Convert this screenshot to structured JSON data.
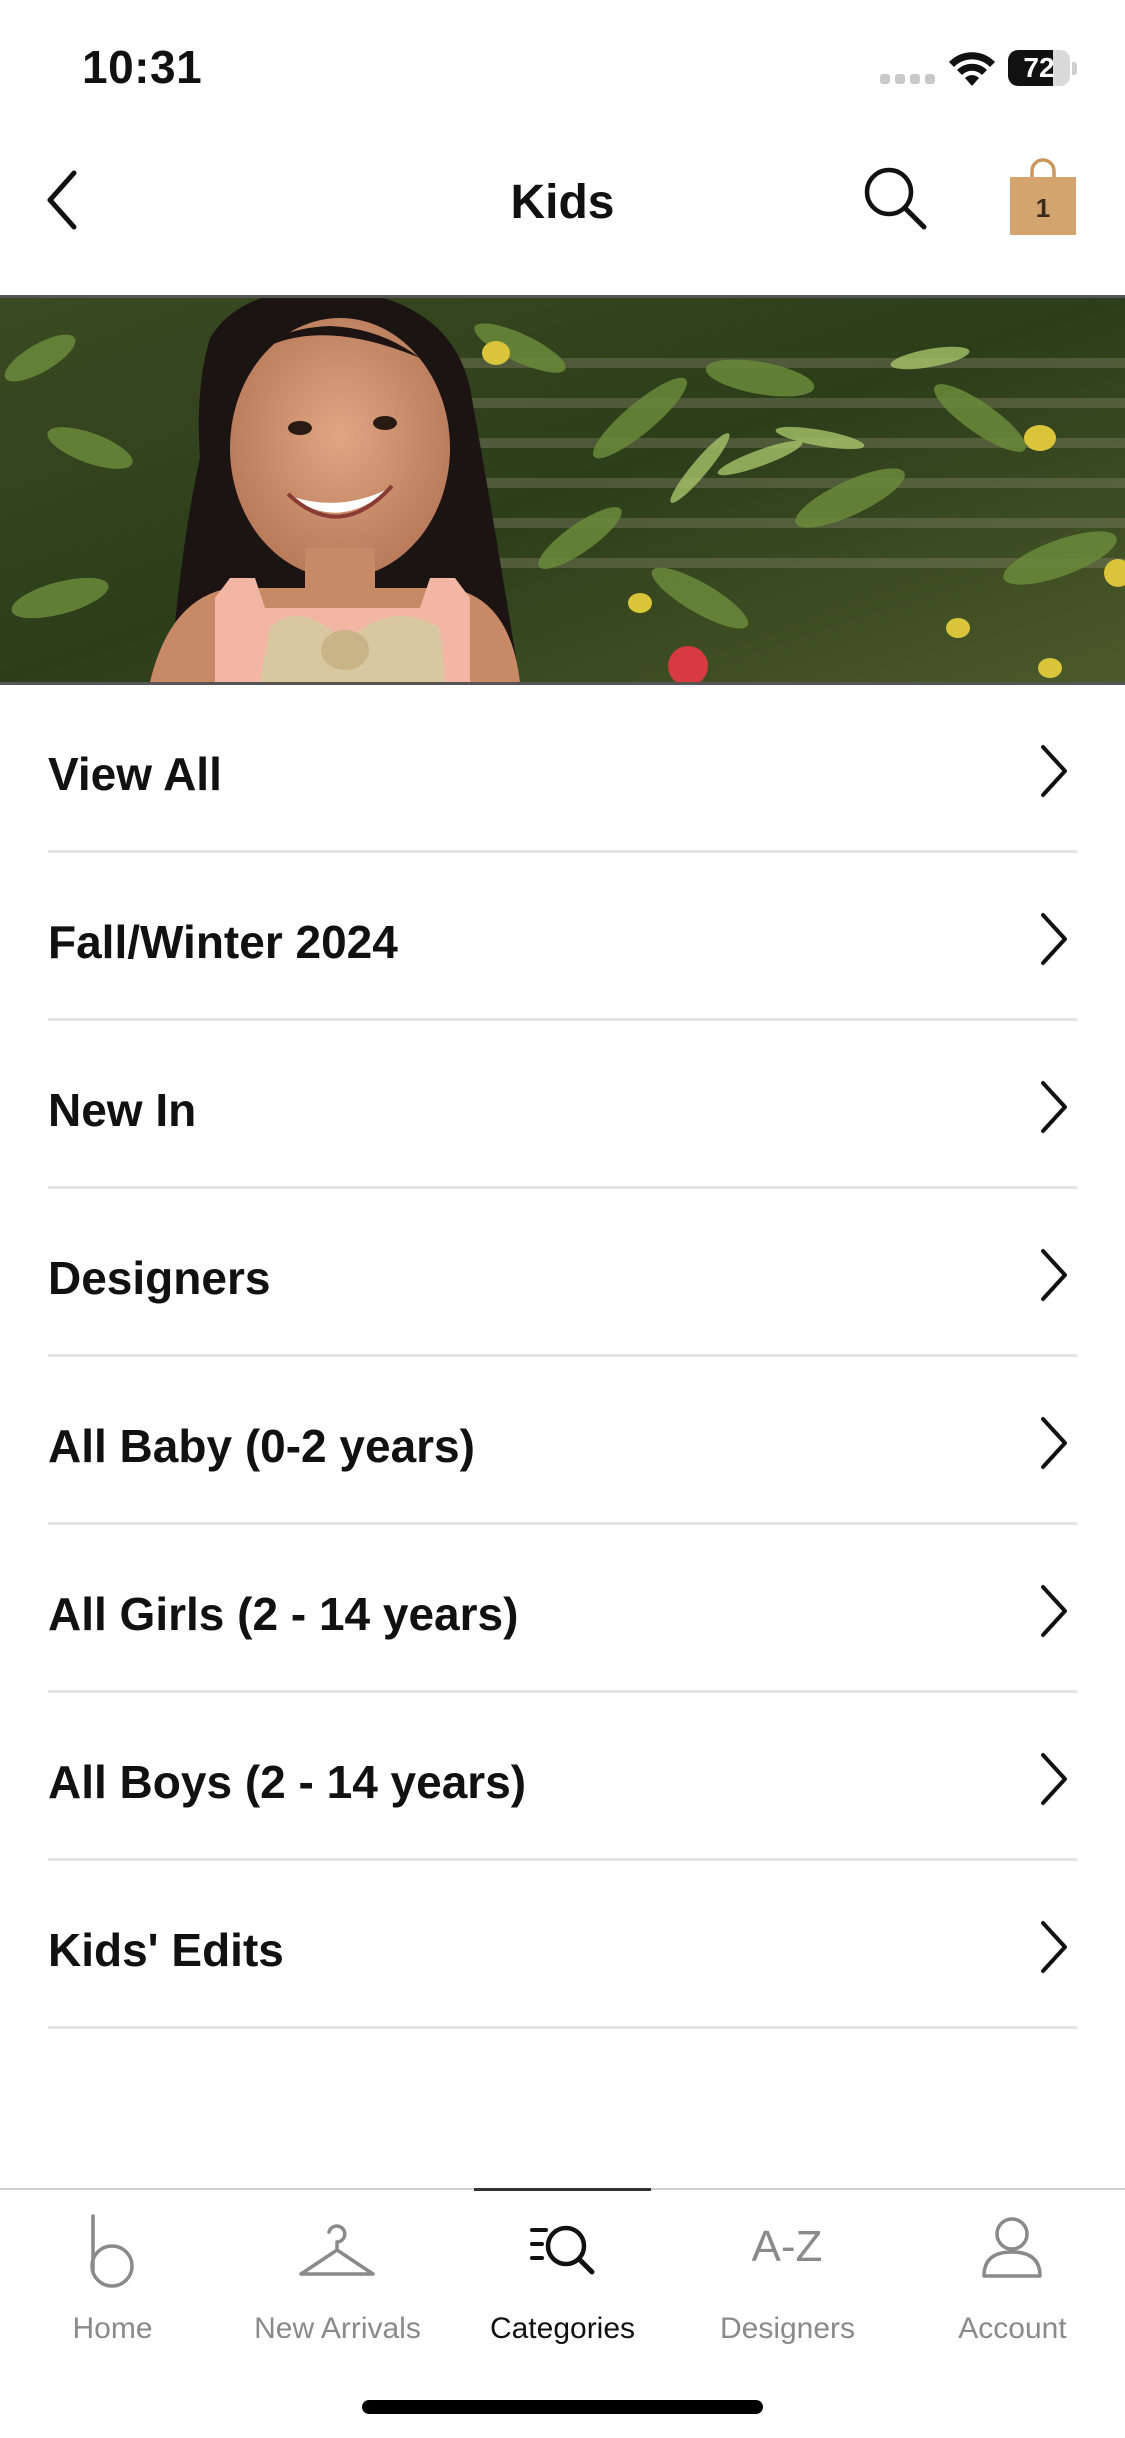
{
  "status_bar": {
    "time": "10:31",
    "battery": "72",
    "battery_level": 0.72
  },
  "header": {
    "title": "Kids",
    "bag_count": "1",
    "bag_color": "#d3a46e"
  },
  "menu": {
    "items": [
      {
        "label": "View All"
      },
      {
        "label": "Fall/Winter 2024"
      },
      {
        "label": "New In"
      },
      {
        "label": "Designers"
      },
      {
        "label": "All Baby (0-2 years)"
      },
      {
        "label": "All Girls (2 - 14 years)"
      },
      {
        "label": "All Boys (2 - 14 years)"
      },
      {
        "label": "Kids' Edits"
      }
    ]
  },
  "tabbar": {
    "tabs": [
      {
        "label": "Home",
        "icon": "b-logo-icon"
      },
      {
        "label": "New Arrivals",
        "icon": "hanger-icon"
      },
      {
        "label": "Categories",
        "icon": "categories-search-icon",
        "active": true
      },
      {
        "label": "Designers",
        "icon": "a-z-icon",
        "icon_text": "A-Z"
      },
      {
        "label": "Account",
        "icon": "person-icon"
      }
    ]
  }
}
